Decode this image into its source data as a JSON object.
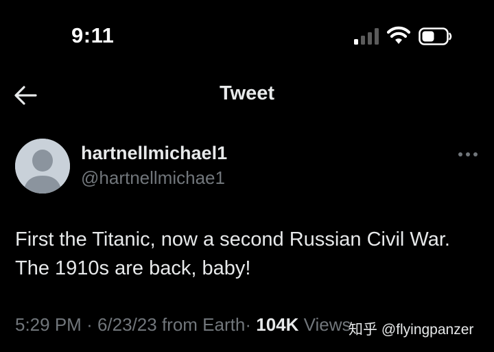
{
  "status_bar": {
    "time": "9:11",
    "signal_icon": "cellular-signal-icon",
    "wifi_icon": "wifi-icon",
    "battery_icon": "battery-icon"
  },
  "header": {
    "back_icon": "arrow-left-icon",
    "title": "Tweet"
  },
  "tweet": {
    "display_name": "hartnellmichael1",
    "handle": "@hartnellmichae1",
    "more_icon": "more-horizontal-icon",
    "text": "First the Titanic, now a second Russian Civil War. The 1910s are back, baby!",
    "time": "5:29 PM",
    "date": "6/23/23",
    "source": "from Earth",
    "separator": "·",
    "views_count": "104K",
    "views_label": "Views"
  },
  "watermark": "知乎 @flyingpanzer",
  "colors": {
    "background": "#000000",
    "text_primary": "#e7e9ea",
    "text_secondary": "#71767b",
    "avatar_bg": "#c9d1d9",
    "avatar_fg": "#8b949e"
  }
}
